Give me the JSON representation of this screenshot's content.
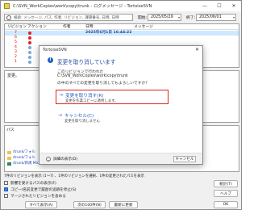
{
  "window": {
    "title": "C:\\SVN_WorkCopies\\work\\copy\\trunk - ログメッセージ - TortoiseSVN",
    "minimize": "—",
    "maximize": "☐",
    "close": "✕"
  },
  "filter": {
    "search_placeholder": "検索: メッセージ, パス, 作者, リビジョン, 課題番号, 日時, 日時",
    "from_label": "開始:",
    "from_date": "2025/05/29",
    "to_label": "終了:",
    "to_date": "2025/06/01"
  },
  "log": {
    "columns": [
      "リビジョン",
      "アクション",
      "作者",
      "日時",
      "メッセージ"
    ],
    "rows": [
      {
        "rev": "7",
        "date": "2025年6月1日 16:44:22",
        "selected": true
      },
      {
        "rev": "6"
      },
      {
        "rev": "5"
      },
      {
        "rev": "4"
      },
      {
        "rev": "3"
      },
      {
        "rev": "2"
      },
      {
        "rev": "1"
      }
    ]
  },
  "message_pane": {
    "text": "変更。"
  },
  "paths": {
    "header": "パス",
    "rows": [
      {
        "path": "/trunk/フォル",
        "action": ""
      },
      {
        "path": "/trunk/フォル",
        "action": ""
      },
      {
        "path": "/trunk/新規 Microsoft Excel ワークシート.xlsx",
        "action": "変更"
      }
    ]
  },
  "footer": {
    "info": "7件のリビジョンを表示 (1〜7) 、1件のリビジョンを選択、1件の変更されたパスを表示",
    "show_all_affected": "影響を受けるパスの表示(F)",
    "stop_on_copy": "コピー/名前変更で履歴の追跡を停止(S)",
    "include_merged": "マージされたリビジョンを含める",
    "all_button": "すべて表示(A)",
    "next100_button": "次の100件(N)",
    "refresh_button": "最新に更新",
    "stats_button": "統計(T)",
    "help_button": "ヘルプ",
    "ok_button": "OK"
  },
  "colors": {
    "accent_blue": "#1f5fc0",
    "highlight_red": "#dd2222",
    "selection": "#cde8ff"
  },
  "dialog": {
    "title": "TortoiseSVN",
    "close": "✕",
    "heading": "変更を取り消しています",
    "desc_line1": "このリビジョンで行われた",
    "desc_line2": "C:\\SVN_WorkCopies\\work\\copy\\trunk",
    "desc_line3": "の中のすべての変更を取り消してもよろしいですか？",
    "primary_title": "変更を取り消す(R)",
    "primary_sub": "変更を作業コピーに適用します。",
    "secondary_title": "キャンセル(C)",
    "secondary_sub": "変更を取り消しません",
    "details": "詳細の表示(D)",
    "cancel_button": "キャンセル",
    "arrow": "→",
    "info_icon_glyph": "i"
  }
}
